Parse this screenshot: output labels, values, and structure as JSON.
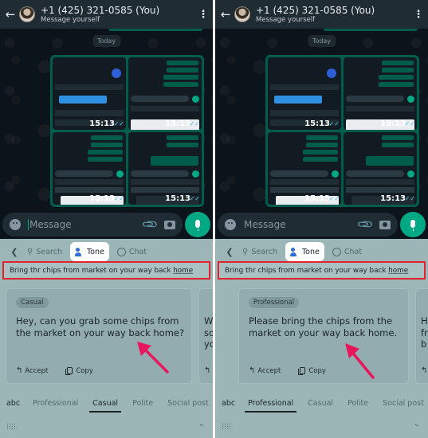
{
  "header": {
    "contact_name": "+1 (425) 321-0585 (You)",
    "subtitle": "Message yourself"
  },
  "chat": {
    "date_chip": "Today",
    "thumbnails": [
      {
        "time": "15:13",
        "content": "keyboard screenshot with tone settings"
      },
      {
        "time": "15:13",
        "content": "chat screenshot with Search tab"
      },
      {
        "time": "15:13",
        "content": "chat screenshot with suggestion"
      },
      {
        "time": "15:13",
        "content": "chat screenshot with Tone tab"
      }
    ]
  },
  "composer": {
    "placeholder": "Message"
  },
  "keyboard": {
    "tabs": [
      {
        "label": "Search",
        "icon": "search-icon"
      },
      {
        "label": "Tone",
        "icon": "tone-icon"
      },
      {
        "label": "Chat",
        "icon": "chat-icon"
      }
    ],
    "active_tab": "Tone",
    "source_text_prefix": "Bring thr chips from market on your way back ",
    "source_text_underlined": "home",
    "tone_options": [
      "abc",
      "Professional",
      "Casual",
      "Polite",
      "Social post"
    ]
  },
  "panels": [
    {
      "selected_tone": "Casual",
      "card": {
        "tone_chip": "Casual",
        "text": "Hey, can you grab some chips from the market on your way back home?",
        "accept_label": "Accept",
        "copy_label": "Copy"
      },
      "next_card_edge": [
        "W",
        "so",
        "yo"
      ]
    },
    {
      "selected_tone": "Professional",
      "card": {
        "tone_chip": "Professional",
        "text": "Please bring the chips from the market on your way back home.",
        "accept_label": "Accept",
        "copy_label": "Copy"
      },
      "next_card_edge": [
        "H",
        "fr",
        "b"
      ]
    }
  ],
  "annotation": {
    "highlight_color": "#e0242f",
    "arrow_color": "#e8175d"
  }
}
